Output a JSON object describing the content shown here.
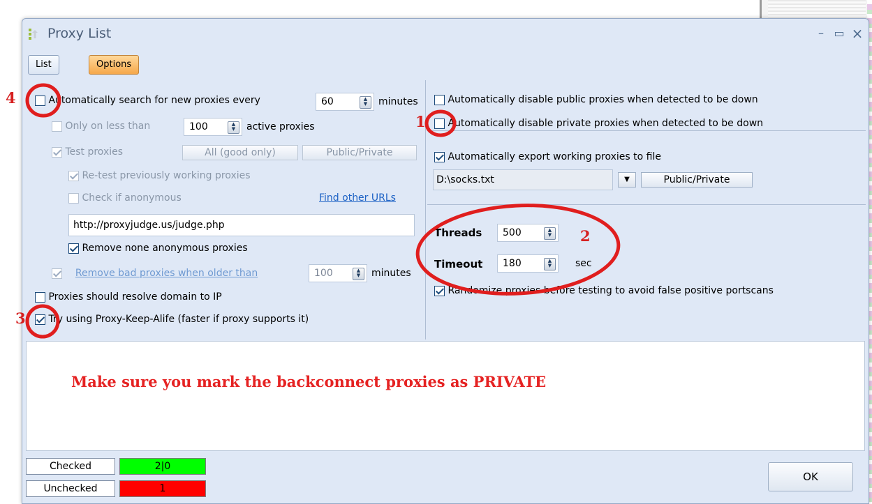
{
  "window": {
    "title": "Proxy List",
    "minimize": "–",
    "maximize": "▭",
    "close": "×"
  },
  "tabs": [
    {
      "label": "List",
      "active": false
    },
    {
      "label": "Options",
      "active": true
    }
  ],
  "left": {
    "auto_search": {
      "label": "Automatically search for new proxies every",
      "checked": false,
      "value": "60",
      "unit": "minutes"
    },
    "only_less": {
      "label": "Only on less than",
      "checked": false,
      "value": "100",
      "unit": "active proxies"
    },
    "test_proxies": {
      "label": "Test proxies",
      "checked": true,
      "btn_all": "All (good only)",
      "btn_pubpriv": "Public/Private"
    },
    "retest": {
      "label": "Re-test previously working proxies",
      "checked": true
    },
    "check_anon": {
      "label": "Check if anonymous",
      "checked": false,
      "link": "Find other URLs"
    },
    "judge_url": "http://proxyjudge.us/judge.php",
    "remove_none_anon": {
      "label": "Remove none anonymous proxies",
      "checked": true
    },
    "remove_bad": {
      "label": "Remove bad proxies when older than",
      "checked": true,
      "value": "100",
      "unit": "minutes"
    },
    "resolve_domain": {
      "label": "Proxies should resolve domain to IP",
      "checked": false
    },
    "keep_alife": {
      "label": "Try using Proxy-Keep-Alife (faster if proxy supports it)",
      "checked": true
    }
  },
  "right": {
    "disable_public": {
      "label": "Automatically disable public proxies when detected to be down",
      "checked": false
    },
    "disable_private": {
      "label": "Automatically disable private proxies when detected to be down",
      "checked": false
    },
    "export": {
      "label": "Automatically export working proxies to file",
      "checked": true,
      "path": "D:\\socks.txt",
      "btn": "Public/Private"
    },
    "threads": {
      "label": "Threads",
      "value": "500"
    },
    "timeout": {
      "label": "Timeout",
      "value": "180",
      "unit": "sec"
    },
    "randomize": {
      "label": "Randomize proxies before testing to avoid false positive portscans",
      "checked": true
    }
  },
  "message": "Make sure you mark the backconnect proxies as PRIVATE",
  "status": {
    "checked_label": "Checked",
    "checked_value": "2|0",
    "checked_color": "#00ff00",
    "unchecked_label": "Unchecked",
    "unchecked_value": "1",
    "unchecked_color": "#ff0000"
  },
  "ok_label": "OK",
  "annotations": [
    "1",
    "2",
    "3",
    "4"
  ],
  "annotation_color": "#e01e1e"
}
